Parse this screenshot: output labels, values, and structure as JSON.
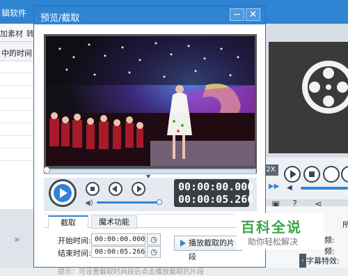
{
  "background_app": {
    "title": "辑软件",
    "tab1": "加素材",
    "tab2": "转",
    "list_header": "中的时间",
    "speed_button": "2X",
    "right_labels": [
      "频:",
      "频:",
      "字幕特效:"
    ],
    "right_tab": "所"
  },
  "dialog": {
    "title": "预览/截取",
    "minimize_label": "−",
    "close_label": "✕",
    "current_time": "00:00:00.000",
    "total_time": "00:00:05.266",
    "tabs": [
      {
        "label": "截取",
        "active": true
      },
      {
        "label": "魔术功能",
        "active": false
      }
    ],
    "start_label": "开始时间:",
    "start_value": "00:00:00.000",
    "end_label": "结束时间:",
    "end_value": "00:00:05.266",
    "play_clip_label": "播放截取的片段",
    "hint": "提示：可设置截取时间段后点击播放截取的片段"
  },
  "watermark": {
    "main": "百科全说",
    "sub": "助你轻松解决"
  },
  "colors": {
    "accent": "#2f84d3",
    "titlebar": "#2f84d3",
    "watermark_green": "#3aa64a"
  }
}
